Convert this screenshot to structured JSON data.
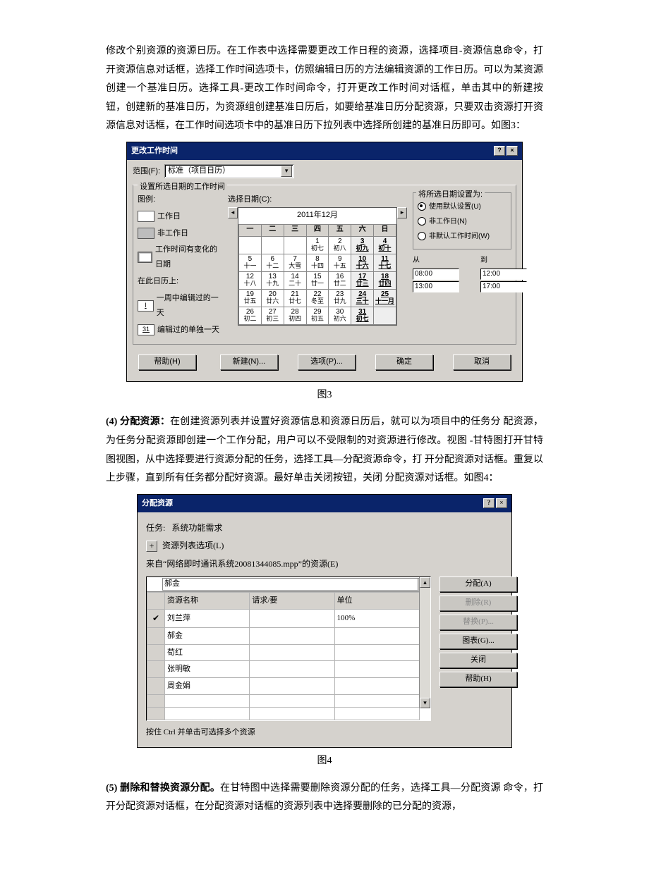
{
  "para1": "修改个别资源的资源日历。在工作表中选择需要更改工作日程的资源，选择项目-资源信息命令，打开资源信息对话框，选择工作时间选项卡，仿照编辑日历的方法编辑资源的工作日历。可以为某资源创建一个基准日历。选择工具-更改工作时间命令，打开更改工作时间对话框，单击其中的新建按钮，创建新的基准日历，为资源组创建基准日历后，如要给基准日历分配资源，只要双击资源打开资源信息对话框，在工作时间选项卡中的基准日历下拉列表中选择所创建的基准日历即可。如图3：",
  "fig3_caption": "图3",
  "para4_lead": "(4)  分配资源：",
  "para4_body": "在创建资源列表并设置好资源信息和资源日历后，就可以为项目中的任务分 配资源，为任务分配资源即创建一个工作分配，用户可以不受限制的对资源进行修改。视图 -甘特图打开甘特图视图，从中选择要进行资源分配的任务，选择工具—分配资源命令，打 开分配资源对话框。重复以上步骤，直到所有任务都分配好资源。最好单击关闭按钮，关闭 分配资源对话框。如图4：",
  "fig4_caption": "图4",
  "para5_lead": "(5)  删除和替换资源分配。",
  "para5_body": "在甘特图中选择需要删除资源分配的任务，选择工具—分配资源 命令，打开分配资源对话框，在分配资源对话框的资源列表中选择要删除的已分配的资源，",
  "dlg1": {
    "title": "更改工作时间",
    "range_label": "范围(F):",
    "range_value": "标准（项目日历）",
    "group_label": "设置所选日期的工作时间",
    "legend_label": "图例:",
    "legend": {
      "work": "工作日",
      "nonwork": "非工作日",
      "changed": "工作时间有变化的日期",
      "in_cal": "在此日历上:",
      "edited_week": "一周中编辑过的一天",
      "edited_single": "编辑过的单独一天"
    },
    "select_date_label": "选择日期(C):",
    "calendar_title": "2011年12月",
    "weekdays": [
      "一",
      "二",
      "三",
      "四",
      "五",
      "六",
      "日"
    ],
    "cells": [
      [
        [
          "",
          ""
        ],
        [
          "",
          ""
        ],
        [
          "",
          ""
        ],
        [
          "1",
          "初七"
        ],
        [
          "2",
          "初八"
        ],
        [
          "3",
          "初九"
        ],
        [
          "4",
          "初十"
        ]
      ],
      [
        [
          "5",
          "十一"
        ],
        [
          "6",
          "十二"
        ],
        [
          "7",
          "大雪"
        ],
        [
          "8",
          "十四"
        ],
        [
          "9",
          "十五"
        ],
        [
          "10",
          "十六"
        ],
        [
          "11",
          "十七"
        ]
      ],
      [
        [
          "12",
          "十八"
        ],
        [
          "13",
          "十九"
        ],
        [
          "14",
          "二十"
        ],
        [
          "15",
          "廿一"
        ],
        [
          "16",
          "廿二"
        ],
        [
          "17",
          "廿三"
        ],
        [
          "18",
          "廿四"
        ]
      ],
      [
        [
          "19",
          "廿五"
        ],
        [
          "20",
          "廿六"
        ],
        [
          "21",
          "廿七"
        ],
        [
          "22",
          "冬至"
        ],
        [
          "23",
          "廿九"
        ],
        [
          "24",
          "三十"
        ],
        [
          "25",
          "十一月"
        ]
      ],
      [
        [
          "26",
          "初二"
        ],
        [
          "27",
          "初三"
        ],
        [
          "28",
          "初四"
        ],
        [
          "29",
          "初五"
        ],
        [
          "30",
          "初六"
        ],
        [
          "31",
          "初七"
        ],
        [
          "",
          ""
        ]
      ]
    ],
    "set_label": "将所选日期设置为:",
    "radios": {
      "default": "使用默认设置(U)",
      "nonwork": "非工作日(N)",
      "nondef": "非默认工作时间(W)"
    },
    "from": "从",
    "to": "到",
    "times": {
      "f1": "08:00",
      "t1": "12:00",
      "f2": "13:00",
      "t2": "17:00"
    },
    "buttons": {
      "help": "帮助(H)",
      "new": "新建(N)...",
      "options": "选项(P)...",
      "ok": "确定",
      "cancel": "取消"
    }
  },
  "dlg2": {
    "title": "分配资源",
    "task_label": "任务:",
    "task_value": "系统功能需求",
    "list_options": "资源列表选项(L)",
    "source_line": "来自“网络即时通讯系统20081344085.mpp”的资源(E)",
    "combo_value": "郝金",
    "columns": {
      "name": "资源名称",
      "req": "请求/要",
      "unit": "单位"
    },
    "rows": [
      {
        "mark": "✔",
        "name": "刘兰萍",
        "req": "",
        "unit": "100%"
      },
      {
        "mark": "",
        "name": "郝金",
        "req": "",
        "unit": ""
      },
      {
        "mark": "",
        "name": "荀红",
        "req": "",
        "unit": ""
      },
      {
        "mark": "",
        "name": "张明敏",
        "req": "",
        "unit": ""
      },
      {
        "mark": "",
        "name": "周金娟",
        "req": "",
        "unit": ""
      },
      {
        "mark": "",
        "name": "",
        "req": "",
        "unit": ""
      },
      {
        "mark": "",
        "name": "",
        "req": "",
        "unit": ""
      }
    ],
    "buttons": {
      "assign": "分配(A)",
      "remove": "删除(R)",
      "replace": "替换(P)...",
      "graph": "图表(G)...",
      "close": "关闭",
      "help": "帮助(H)"
    },
    "hint": "按住 Ctrl 并单击可选择多个资源"
  }
}
